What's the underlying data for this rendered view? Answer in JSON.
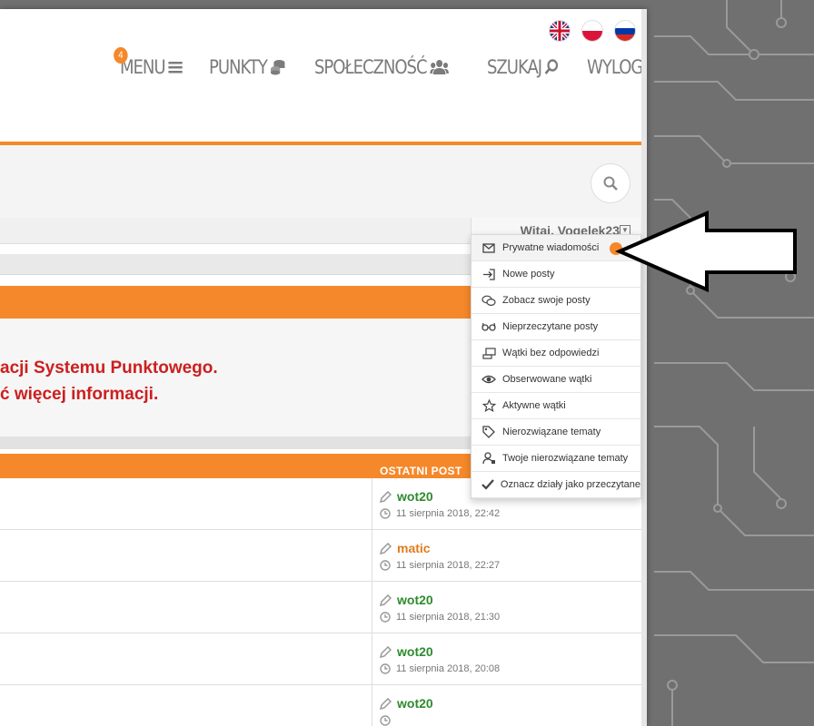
{
  "header": {
    "flags": [
      "flag-uk",
      "flag-pl",
      "flag-ru"
    ],
    "nav": {
      "menu_label": "MENU",
      "menu_badge": "4",
      "points_label": "PUNKTY",
      "community_label": "SPOŁECZNOŚĆ",
      "search_label": "SZUKAJ",
      "logout_label": "WYLOGUJ"
    }
  },
  "user": {
    "welcome": "Witaj, Vogelek23"
  },
  "notice": {
    "line1": "acji Systemu Punktowego.",
    "line2": "ć więcej informacji."
  },
  "table": {
    "col_last_post": "OSTATNI POST",
    "rows": [
      {
        "author": "wot20",
        "author_color": "#2e8b2e",
        "date": "11 sierpnia 2018, 22:42"
      },
      {
        "author": "matic",
        "author_color": "#e07b1f",
        "date": "11 sierpnia 2018, 22:27"
      },
      {
        "author": "wot20",
        "author_color": "#2e8b2e",
        "date": "11 sierpnia 2018, 21:30"
      },
      {
        "author": "wot20",
        "author_color": "#2e8b2e",
        "date": "11 sierpnia 2018, 20:08"
      },
      {
        "author": "wot20",
        "author_color": "#2e8b2e",
        "date": ""
      }
    ]
  },
  "dropdown": {
    "items": [
      {
        "label": "Prywatne wiadomości",
        "icon": "envelope-icon"
      },
      {
        "label": "Nowe posty",
        "icon": "signin-icon"
      },
      {
        "label": "Zobacz swoje posty",
        "icon": "comments-icon"
      },
      {
        "label": "Nieprzeczytane posty",
        "icon": "glasses-icon"
      },
      {
        "label": "Wątki bez odpowiedzi",
        "icon": "unanswered-icon"
      },
      {
        "label": "Obserwowane wątki",
        "icon": "eye-icon"
      },
      {
        "label": "Aktywne wątki",
        "icon": "star-icon"
      },
      {
        "label": "Nierozwiązane tematy",
        "icon": "tag-icon"
      },
      {
        "label": "Twoje nierozwiązane tematy",
        "icon": "user-tag-icon"
      },
      {
        "label": "Oznacz działy jako przeczytane",
        "icon": "check-icon"
      }
    ]
  },
  "colors": {
    "accent": "#f5882a",
    "notice_text": "#cc1f1f",
    "nav_text": "#7b7b7b"
  }
}
